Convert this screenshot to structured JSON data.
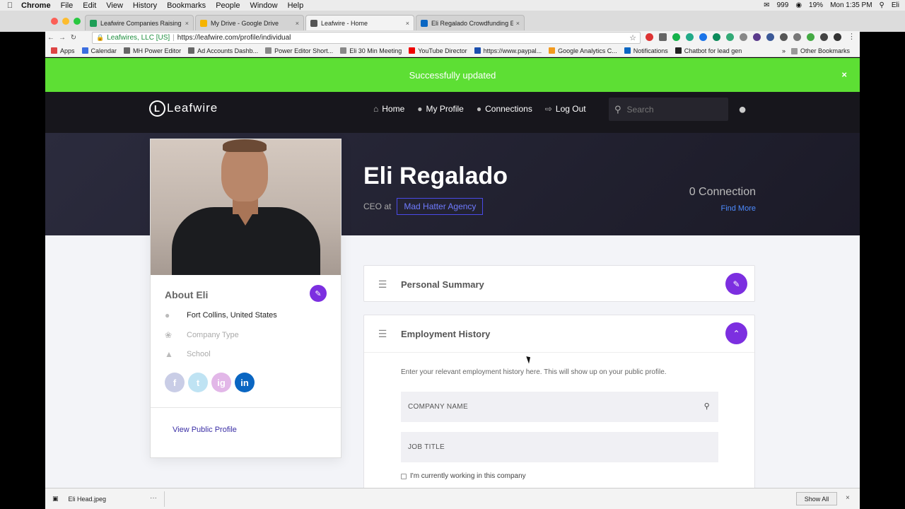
{
  "menubar": {
    "app": "Chrome",
    "items": [
      "File",
      "Edit",
      "View",
      "History",
      "Bookmarks",
      "People",
      "Window",
      "Help"
    ],
    "status_count": "999",
    "battery": "19%",
    "time": "Mon 1:35 PM",
    "user": "Eli"
  },
  "tabs": [
    {
      "label": "Leafwire Companies Raising M",
      "color": "#1e9e57"
    },
    {
      "label": "My Drive - Google Drive",
      "color": "#f5b400"
    },
    {
      "label": "Leafwire - Home",
      "color": "#555555"
    },
    {
      "label": "Eli Regalado Crowdfunding Exp",
      "color": "#0a66c2"
    }
  ],
  "toolbar": {
    "secure_label": "Leafwires, LLC [US]",
    "url": "https://leafwire.com/profile/individual"
  },
  "bookmarks": {
    "items": [
      {
        "label": "Apps",
        "color": "#d44"
      },
      {
        "label": "Calendar",
        "color": "#3b6ee0"
      },
      {
        "label": "MH Power Editor",
        "color": "#666"
      },
      {
        "label": "Ad Accounts Dashb...",
        "color": "#666"
      },
      {
        "label": "Power Editor Short...",
        "color": "#888"
      },
      {
        "label": "Eli 30 Min Meeting",
        "color": "#888"
      },
      {
        "label": "YouTube Director",
        "color": "#e00"
      },
      {
        "label": "https://www.paypal...",
        "color": "#1b4fae"
      },
      {
        "label": "Google Analytics C...",
        "color": "#f29a1e"
      },
      {
        "label": "Notifications",
        "color": "#0a66c2"
      },
      {
        "label": "Chatbot for lead gen",
        "color": "#222"
      }
    ],
    "more": "»",
    "other": "Other Bookmarks"
  },
  "alert": {
    "message": "Successfully updated",
    "close": "×"
  },
  "nav": {
    "logo": "Leafwire",
    "links": [
      {
        "label": "Home",
        "icon": "home-icon"
      },
      {
        "label": "My Profile",
        "icon": "user-icon"
      },
      {
        "label": "Connections",
        "icon": "users-icon"
      },
      {
        "label": "Log Out",
        "icon": "logout-icon"
      }
    ],
    "search_placeholder": "Search"
  },
  "profile": {
    "name": "Eli Regalado",
    "role_prefix": "CEO at",
    "company": "Mad Hatter Agency",
    "connections": "0 Connection",
    "find_more": "Find More"
  },
  "about": {
    "title": "About Eli",
    "location": "Fort Collins, United States",
    "company_type": "Company Type",
    "school": "School",
    "view_public": "View Public Profile",
    "social": [
      {
        "label": "f",
        "color": "#c9cde6"
      },
      {
        "label": "t",
        "color": "#bfe3f3"
      },
      {
        "label": "ig",
        "color": "#e2b7e8"
      },
      {
        "label": "in",
        "color": "#0a66c2"
      }
    ]
  },
  "panels": {
    "summary_title": "Personal Summary",
    "employment_title": "Employment History",
    "employment_desc": "Enter your relevant employment history here. This will show up on your public profile.",
    "company_placeholder": "COMPANY NAME",
    "job_placeholder": "JOB TITLE",
    "checkbox_label": "I'm currently working in this company"
  },
  "downloads": {
    "file": "Eli Head.jpeg",
    "more": "···",
    "show_all": "Show All",
    "close": "×"
  }
}
